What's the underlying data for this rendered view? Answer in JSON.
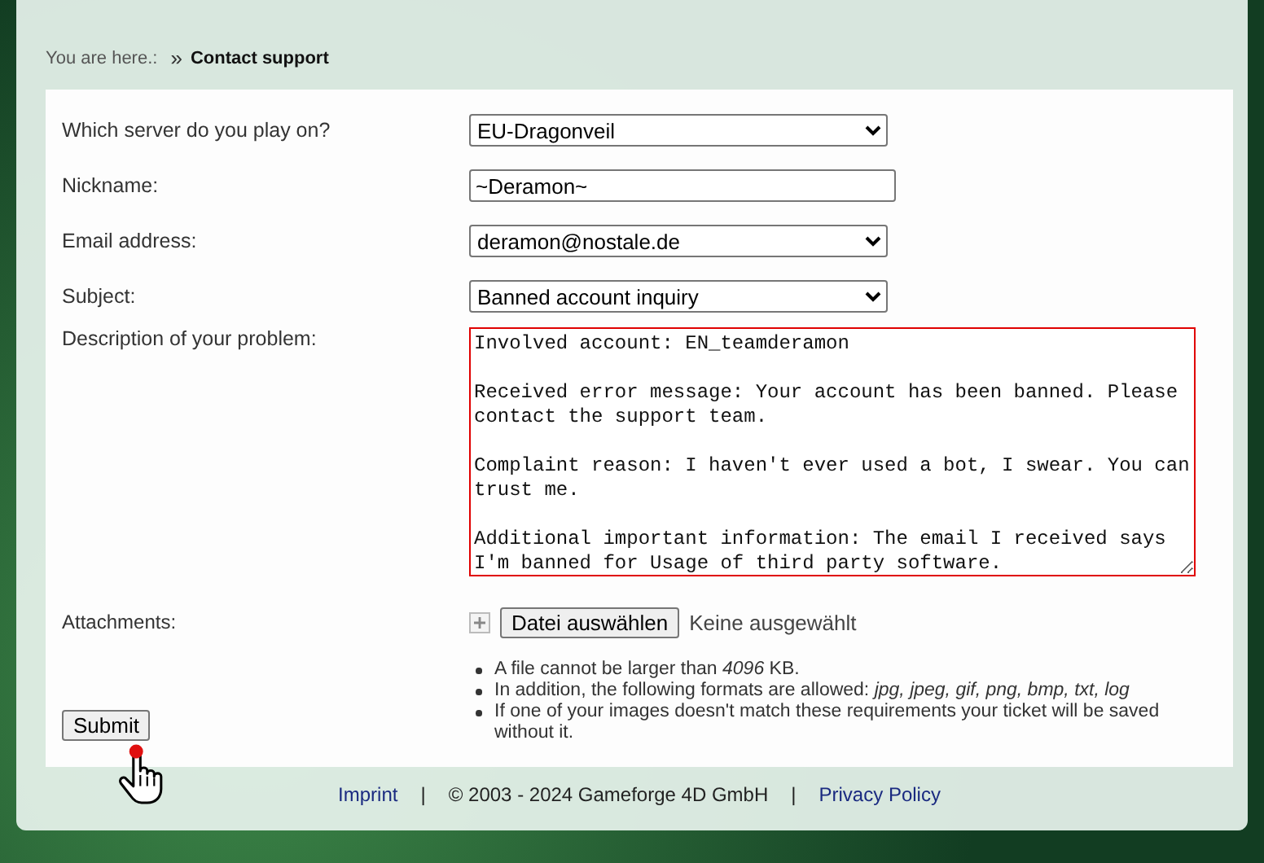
{
  "breadcrumb": {
    "label": "You are here.:",
    "separator": "»",
    "current": "Contact support"
  },
  "fields": [
    {
      "kind": "select",
      "label": "Which server do you play on?",
      "value": "EU-Dragonveil"
    },
    {
      "kind": "text",
      "label": "Nickname:",
      "value": "~Deramon~"
    },
    {
      "kind": "select",
      "label": "Email address:",
      "value": "deramon@nostale.de"
    },
    {
      "kind": "select",
      "label": "Subject:",
      "value": "Banned account inquiry"
    },
    {
      "kind": "textarea",
      "label": "Description of your problem:",
      "value": "Involved account: EN_teamderamon\n\nReceived error message: Your account has been banned. Please contact the support team.\n\nComplaint reason: I haven't ever used a bot, I swear. You can trust me.\n\nAdditional important information: The email I received says I'm banned for Usage of third party software."
    }
  ],
  "attachments": {
    "label": "Attachments:",
    "button": "Datei auswählen",
    "status": "Keine ausgewählt"
  },
  "rules": [
    "A file cannot be larger than *4096* KB.",
    "In addition, the following formats are allowed: *jpg, jpeg, gif, png, bmp, txt, log*",
    "If one of your images doesn't match these requirements your ticket will be saved without it."
  ],
  "submit": "Submit",
  "footer": [
    {
      "kind": "link",
      "text": "Imprint"
    },
    {
      "kind": "sep",
      "text": "|"
    },
    {
      "kind": "text",
      "text": "© 2003 - 2024 Gameforge 4D GmbH"
    },
    {
      "kind": "sep",
      "text": "|"
    },
    {
      "kind": "link",
      "text": "Privacy Policy"
    }
  ]
}
